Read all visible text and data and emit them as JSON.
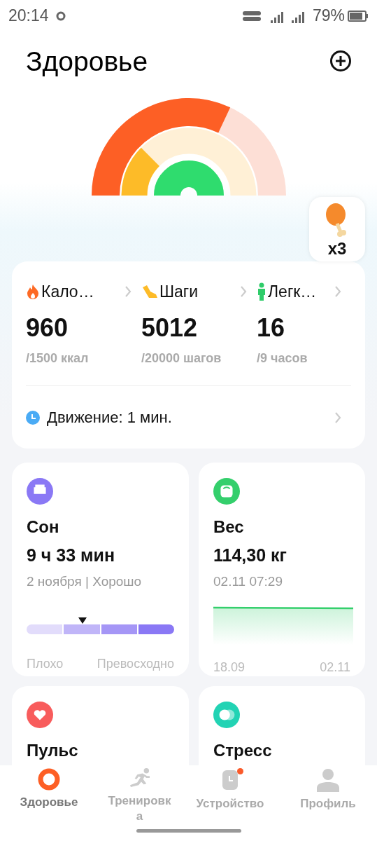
{
  "status_bar": {
    "time": "20:14",
    "battery": "79%"
  },
  "header": {
    "title": "Здоровье"
  },
  "reward": {
    "count": "x3"
  },
  "summary": {
    "stats": [
      {
        "kind": "calories",
        "label": "Кало…",
        "value": "960",
        "goal": "/1500 ккал"
      },
      {
        "kind": "steps",
        "label": "Шаги",
        "value": "5012",
        "goal": "/20000 шагов"
      },
      {
        "kind": "activity",
        "label": "Легк…",
        "value": "16",
        "goal": "/9 часов"
      }
    ],
    "movement": "Движение: 1 мин."
  },
  "cards": [
    {
      "kind": "sleep",
      "color": "#8a78f5",
      "title": "Сон",
      "value": "9 ч 33 мин",
      "subtitle": "2 ноября | Хорошо",
      "low": "Плохо",
      "high": "Превосходно"
    },
    {
      "kind": "weight",
      "color": "#34cf6c",
      "title": "Вес",
      "value": "114,30 кг",
      "subtitle": "02.11 07:29",
      "start": "18.09",
      "end": "02.11"
    },
    {
      "kind": "pulse",
      "color": "#f85c5c",
      "title": "Пульс"
    },
    {
      "kind": "stress",
      "color": "#22d3b4",
      "title": "Стресс"
    }
  ],
  "nav": [
    {
      "kind": "health",
      "label": "Здоровье",
      "selected": true,
      "badge": false
    },
    {
      "kind": "workout",
      "label": "Тренировка",
      "selected": false,
      "badge": false
    },
    {
      "kind": "device",
      "label": "Устройство",
      "selected": false,
      "badge": true
    },
    {
      "kind": "profile",
      "label": "Профиль",
      "selected": false,
      "badge": false
    }
  ]
}
